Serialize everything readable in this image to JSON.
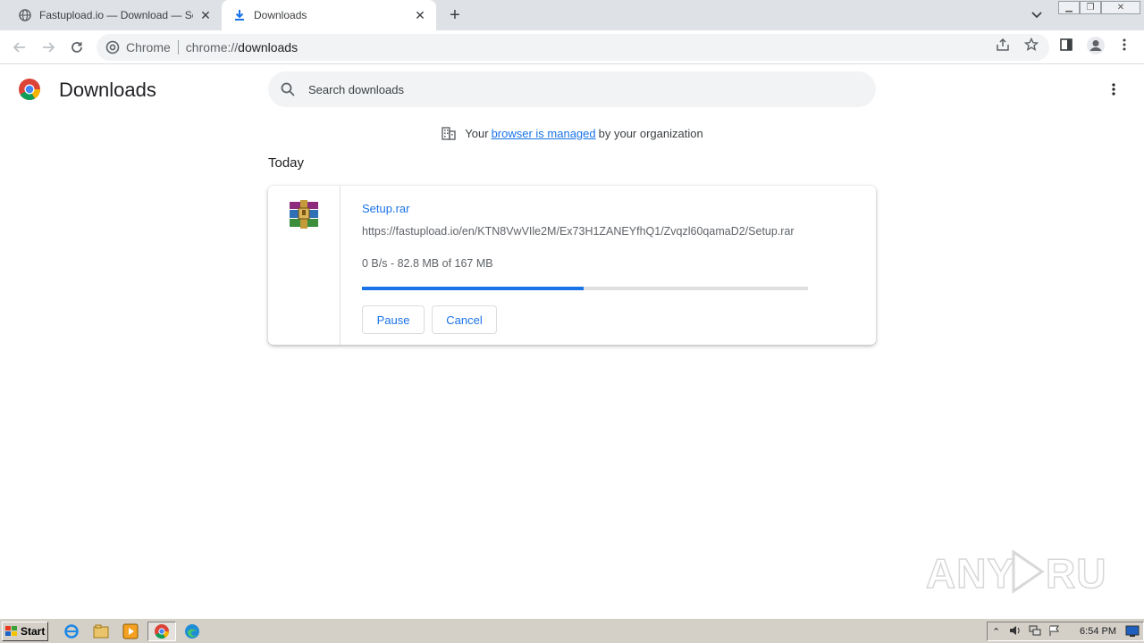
{
  "tabs": [
    {
      "title": "Fastupload.io — Download — Setup.rar",
      "active": false
    },
    {
      "title": "Downloads",
      "active": true
    }
  ],
  "toolbar": {
    "site_chip": "Chrome",
    "url_scheme": "chrome://",
    "url_host": "downloads"
  },
  "page": {
    "title": "Downloads",
    "search_placeholder": "Search downloads",
    "managed_prefix": "Your",
    "managed_link": "browser is managed",
    "managed_suffix": "by your organization",
    "section_today": "Today"
  },
  "download": {
    "file_name": "Setup.rar",
    "url": "https://fastupload.io/en/KTN8VwVIle2M/Ex73H1ZANEYfhQ1/Zvqzl60qamaD2/Setup.rar",
    "status": "0 B/s - 82.8 MB of 167 MB",
    "progress_fraction": 0.496,
    "pause_label": "Pause",
    "cancel_label": "Cancel"
  },
  "watermark": "ANY RUN",
  "taskbar": {
    "start_label": "Start",
    "clock": "6:54 PM"
  },
  "colors": {
    "accent": "#1a73e8",
    "tabstrip": "#dee1e6",
    "taskbar": "#d4d0c8"
  }
}
